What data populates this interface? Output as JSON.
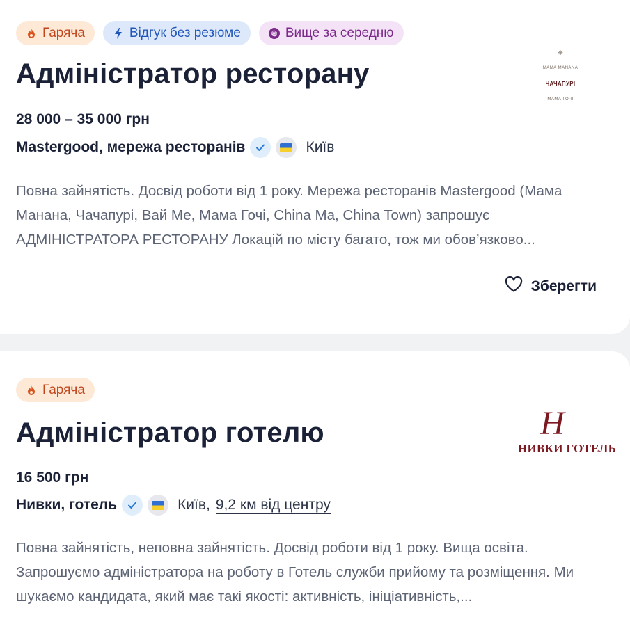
{
  "vacancies": [
    {
      "tags": [
        {
          "label": "Гаряча",
          "icon": "flame-icon"
        },
        {
          "label": "Відгук без резюме",
          "icon": "lightning-icon"
        },
        {
          "label": "Вище за середню",
          "icon": "hryvnia-coin-icon"
        }
      ],
      "title": "Адміністратор ресторану",
      "salary": "28 000 – 35 000 грн",
      "company": "Mastergood, мережа ресторанів",
      "city": "Київ",
      "description": "Повна зайнятість. Досвід роботи від 1 року. Мережа ресторанів Mastergood (Мама Манана, Чачапурі, Вай Ме, Мама Гочі, China Ma, China Town) запрошує АДМІНІСТРАТОРА РЕСТОРАНУ Локацій по місту багато, тож ми обов’язково...",
      "save_label": "Зберегти",
      "logo": {
        "top": "MAMA MANANA",
        "middle": "ЧАЧАПУРІ",
        "bottom": "МАМА ГОЧІ"
      }
    },
    {
      "tags": [
        {
          "label": "Гаряча",
          "icon": "flame-icon"
        }
      ],
      "title": "Адміністратор готелю",
      "salary": "16 500 грн",
      "company": "Нивки, готель",
      "city": "Київ,",
      "distance": "9,2 км від центру",
      "description": "Повна зайнятість, неповна зайнятість. Досвід роботи від 1 року. Вища освіта. Запрошуємо адміністратора на роботу в Готель служби прийому та розміщення. Ми шукаємо кандидата, який має такі якості: активність, ініціативність,...",
      "logo": {
        "monogram": "H",
        "text": "НИВКИ ГОТЕЛЬ"
      }
    }
  ],
  "colors": {
    "hot": "#c2451c",
    "quick": "#1f56b8",
    "salary_tag": "#7b2a8a",
    "title": "#1b2238",
    "description": "#5c6374",
    "logo_red": "#7d1821"
  }
}
